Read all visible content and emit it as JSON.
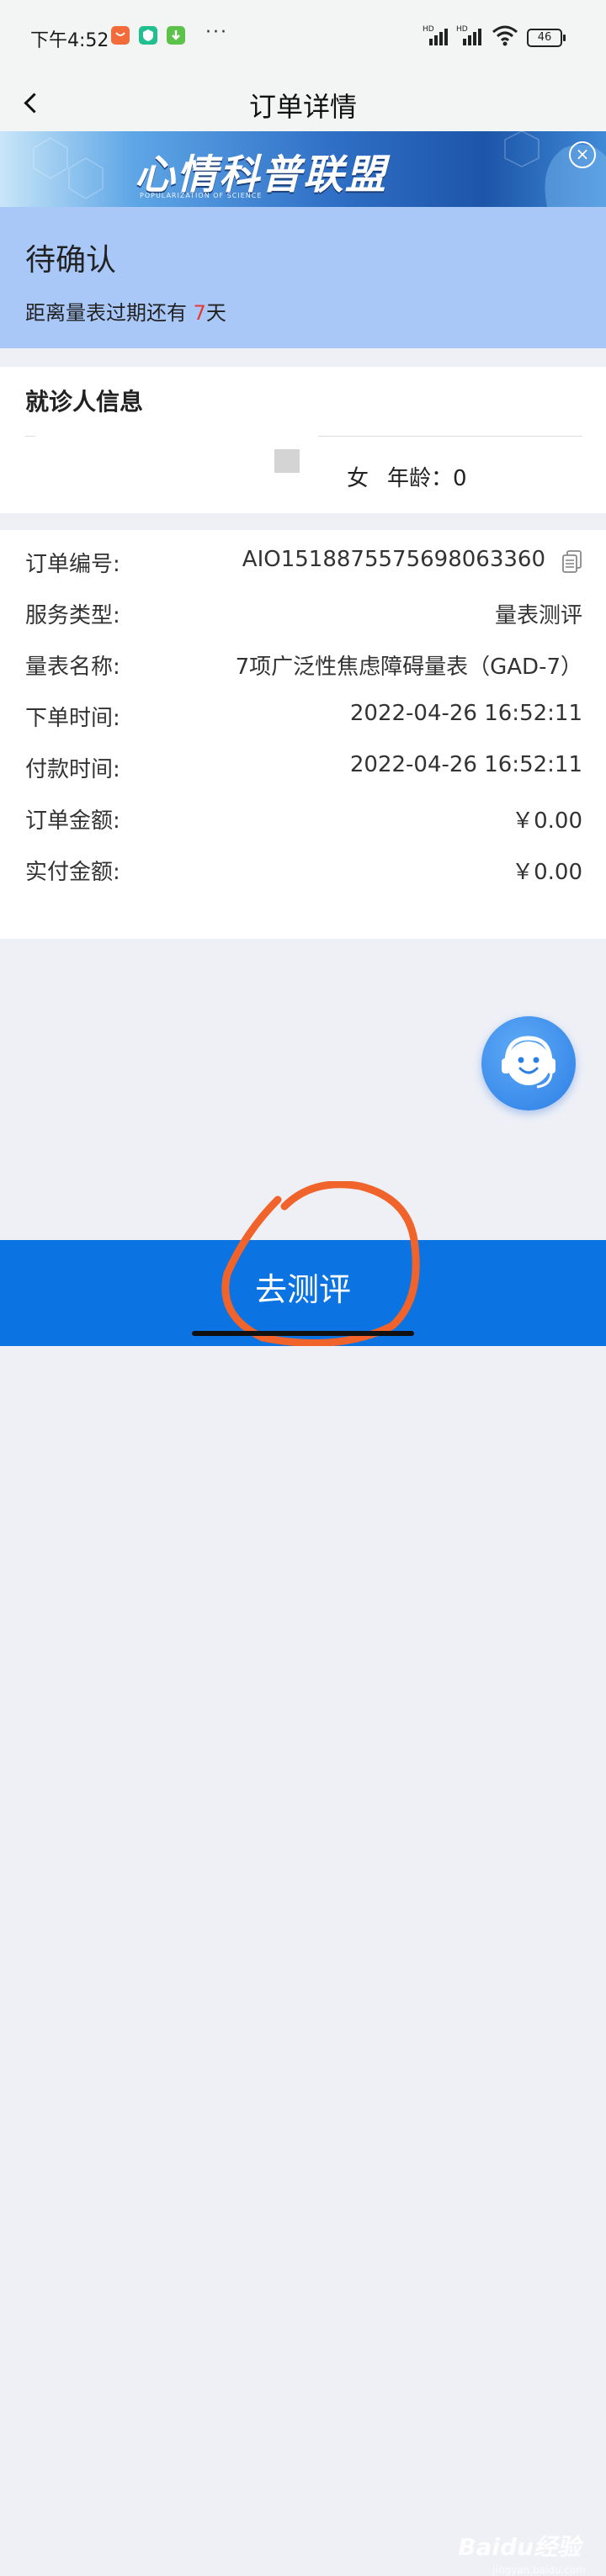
{
  "status_bar": {
    "time": "下午4:52",
    "battery": "46",
    "network_labels": [
      "HD",
      "HD"
    ],
    "icons": [
      "app-orange-icon",
      "app-green-shield-icon",
      "app-green-download-icon",
      "more-dots-icon",
      "signal-icon",
      "signal-icon",
      "wifi-icon",
      "battery-icon"
    ]
  },
  "nav": {
    "title": "订单详情",
    "back_icon": "chevron-left-icon"
  },
  "banner": {
    "title": "心情科普联盟",
    "subtitle": "POPULARIZATION OF SCIENCE",
    "close_icon": "close-circle-icon"
  },
  "order_status": {
    "title": "待确认",
    "expire_prefix": "距离量表过期还有 ",
    "expire_days": "7",
    "expire_suffix": "天",
    "highlight_color": "#e53935"
  },
  "patient": {
    "heading": "就诊人信息",
    "gender": "女",
    "age_label": "年龄：",
    "age_value": "0"
  },
  "order": {
    "rows": [
      {
        "label": "订单编号:",
        "value": "AIO1518875575698063360",
        "icon": "copy-icon"
      },
      {
        "label": "服务类型:",
        "value": "量表测评"
      },
      {
        "label": "量表名称:",
        "value": "7项广泛性焦虑障碍量表（GAD-7）"
      },
      {
        "label": "下单时间:",
        "value": "2022-04-26 16:52:11"
      },
      {
        "label": "付款时间:",
        "value": "2022-04-26 16:52:11"
      },
      {
        "label": "订单金额:",
        "value": "￥0.00"
      },
      {
        "label": "实付金额:",
        "value": "￥0.00"
      }
    ]
  },
  "customer_service": {
    "icon": "headset-agent-icon"
  },
  "bottom": {
    "cta_label": "去测评",
    "accent_color": "#0b74e2"
  },
  "watermark": {
    "text": "Baidu经验",
    "sub": "jingyan.baidu.com"
  },
  "annotation_color": "#f0642c"
}
